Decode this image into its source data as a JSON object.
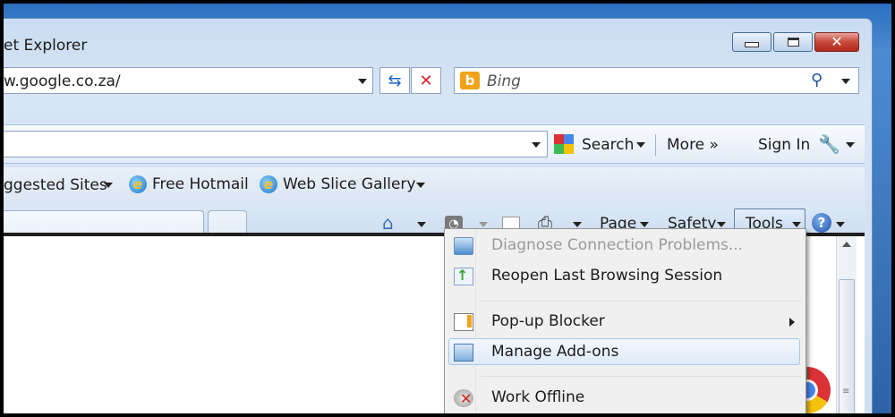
{
  "window": {
    "title": "et Explorer"
  },
  "address": {
    "url": "w.google.co.za/"
  },
  "search": {
    "placeholder": "Bing"
  },
  "google_bar": {
    "search_label": "Search",
    "more_label": "More »",
    "signin_label": "Sign In"
  },
  "favorites": {
    "items": [
      "ggested Sites",
      "Free Hotmail",
      "Web Slice Gallery"
    ]
  },
  "command_bar": {
    "page_label": "Page",
    "safety_label": "Safety",
    "tools_label": "Tools"
  },
  "tools_menu": {
    "items": [
      {
        "label": "Diagnose Connection Problems...",
        "enabled": false,
        "icon": "network-diagnose-icon"
      },
      {
        "label": "Reopen Last Browsing Session",
        "enabled": true,
        "icon": "reopen-session-icon"
      },
      {
        "label": "Pop-up Blocker",
        "enabled": true,
        "icon": "popup-blocker-icon",
        "submenu": true
      },
      {
        "label": "Manage Add-ons",
        "enabled": true,
        "icon": "manage-addons-icon",
        "highlighted": true
      },
      {
        "label": "Work Offline",
        "enabled": true,
        "icon": "work-offline-icon"
      }
    ]
  },
  "colors": {
    "accent": "#3a7bd5",
    "window_frame": "#c9dcf1",
    "menu_bg": "#f0f0f0",
    "highlight_border": "#a8c8ec"
  }
}
